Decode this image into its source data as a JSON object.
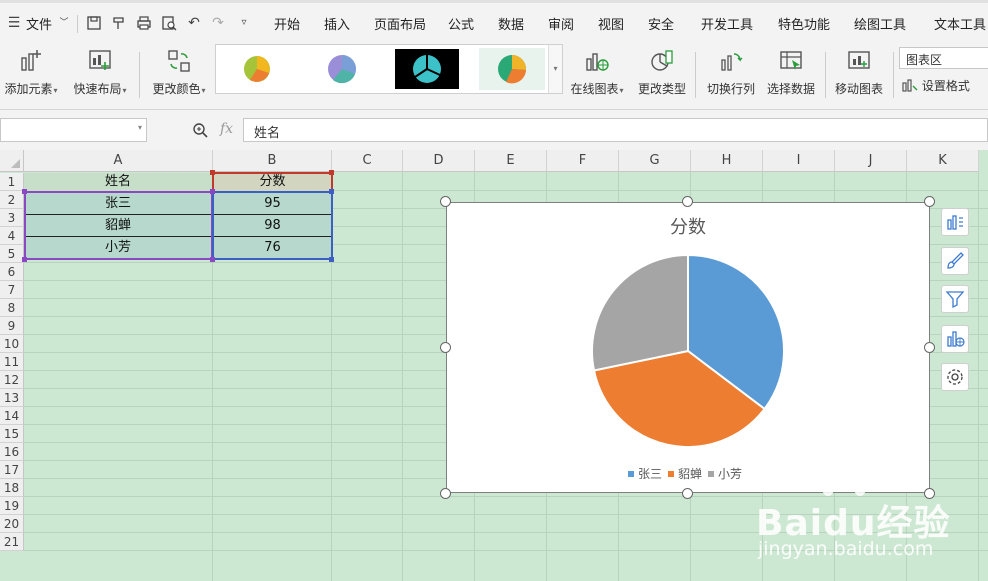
{
  "menubar": {
    "file_label": "文件",
    "tabs": [
      "开始",
      "插入",
      "页面布局",
      "公式",
      "数据",
      "审阅",
      "视图",
      "安全",
      "开发工具",
      "特色功能",
      "绘图工具",
      "文本工具"
    ]
  },
  "ribbon": {
    "add_element": "添加元素",
    "quick_layout": "快速布局",
    "change_color": "更改颜色",
    "online_chart": "在线图表",
    "change_type": "更改类型",
    "switch_row_col": "切换行列",
    "select_data": "选择数据",
    "move_chart": "移动图表",
    "chart_area_value": "图表区",
    "set_format": "设置格式"
  },
  "formula_bar": {
    "name_box_value": "",
    "fx_label": "fx",
    "formula_value": "姓名"
  },
  "sheet": {
    "columns": [
      "A",
      "B",
      "C",
      "D",
      "E",
      "F",
      "G",
      "H",
      "I",
      "J",
      "K"
    ],
    "rows": [
      "1",
      "2",
      "3",
      "4",
      "5",
      "6",
      "7",
      "8",
      "9",
      "10",
      "11",
      "12",
      "13",
      "14",
      "15",
      "16",
      "17",
      "18",
      "19",
      "20",
      "21"
    ],
    "headers": [
      "姓名",
      "分数"
    ],
    "data": [
      [
        "张三",
        "95"
      ],
      [
        "貂蝉",
        "98"
      ],
      [
        "小芳",
        "76"
      ]
    ]
  },
  "chart_data": {
    "type": "pie",
    "title": "分数",
    "categories": [
      "张三",
      "貂蝉",
      "小芳"
    ],
    "values": [
      95,
      98,
      76
    ],
    "colors": [
      "#5b9bd5",
      "#ed7d31",
      "#a5a5a5"
    ],
    "legend_position": "bottom"
  },
  "watermark": {
    "brand": "Baidu经验",
    "url": "jingyan.baidu.com"
  }
}
